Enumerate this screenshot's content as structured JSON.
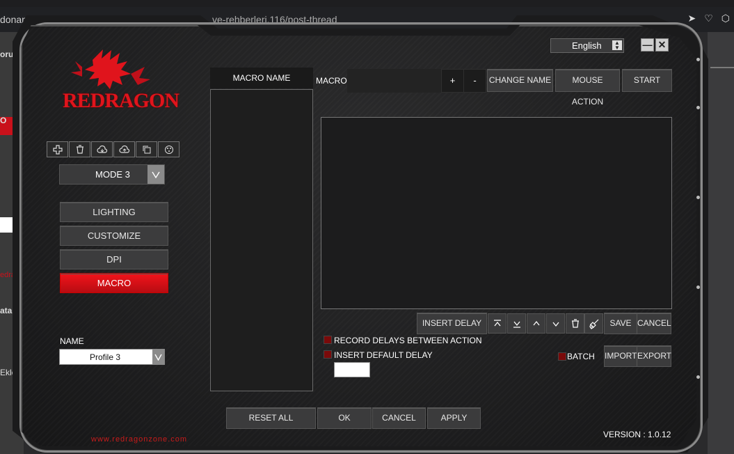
{
  "browser": {
    "url_left": "donanima",
    "url_mid": "ve-rehberleri.116/post-thread"
  },
  "background_left": {
    "snippet1": "oru",
    "snippet2": "O",
    "snippet3": "edrag",
    "snippet4": "atab",
    "snippet5": "Ekle"
  },
  "header": {
    "language": "English",
    "minimize": "—",
    "close": "✕"
  },
  "logo": {
    "brand": "REDRAGON"
  },
  "profile_tools": {
    "icons": [
      "add-icon",
      "trash-icon",
      "cloud-import-icon",
      "cloud-export-icon",
      "copy-icon",
      "reset-icon"
    ]
  },
  "mode": {
    "selected": "MODE 3"
  },
  "nav": {
    "lighting": "LIGHTING",
    "customize": "CUSTOMIZE",
    "dpi": "DPI",
    "macro": "MACRO"
  },
  "profile_name": {
    "label": "NAME",
    "value": "Profile 3"
  },
  "website": "www.redragonzone.com",
  "macro_list": {
    "header": "MACRO NAME"
  },
  "macro_editor": {
    "label": "MACRO",
    "plus": "+",
    "minus": "-",
    "change_name": "CHANGE NAME",
    "mouse_action": "MOUSE ACTION",
    "start": "START",
    "insert_delay": "INSERT DELAY",
    "save": "SAVE",
    "cancel": "CANCEL",
    "record_delays": "RECORD DELAYS BETWEEN ACTION",
    "insert_default_delay": "INSERT DEFAULT DELAY",
    "batch": "BATCH",
    "import": "IMPORT",
    "export": "EXPORT"
  },
  "footer": {
    "reset_all": "RESET ALL",
    "ok": "OK",
    "cancel": "CANCEL",
    "apply": "APPLY",
    "version": "VERSION : 1.0.12"
  },
  "colors": {
    "accent_red": "#e0141c",
    "panel_dark": "#1c1c1d",
    "button_gray": "#3b3b3c"
  }
}
